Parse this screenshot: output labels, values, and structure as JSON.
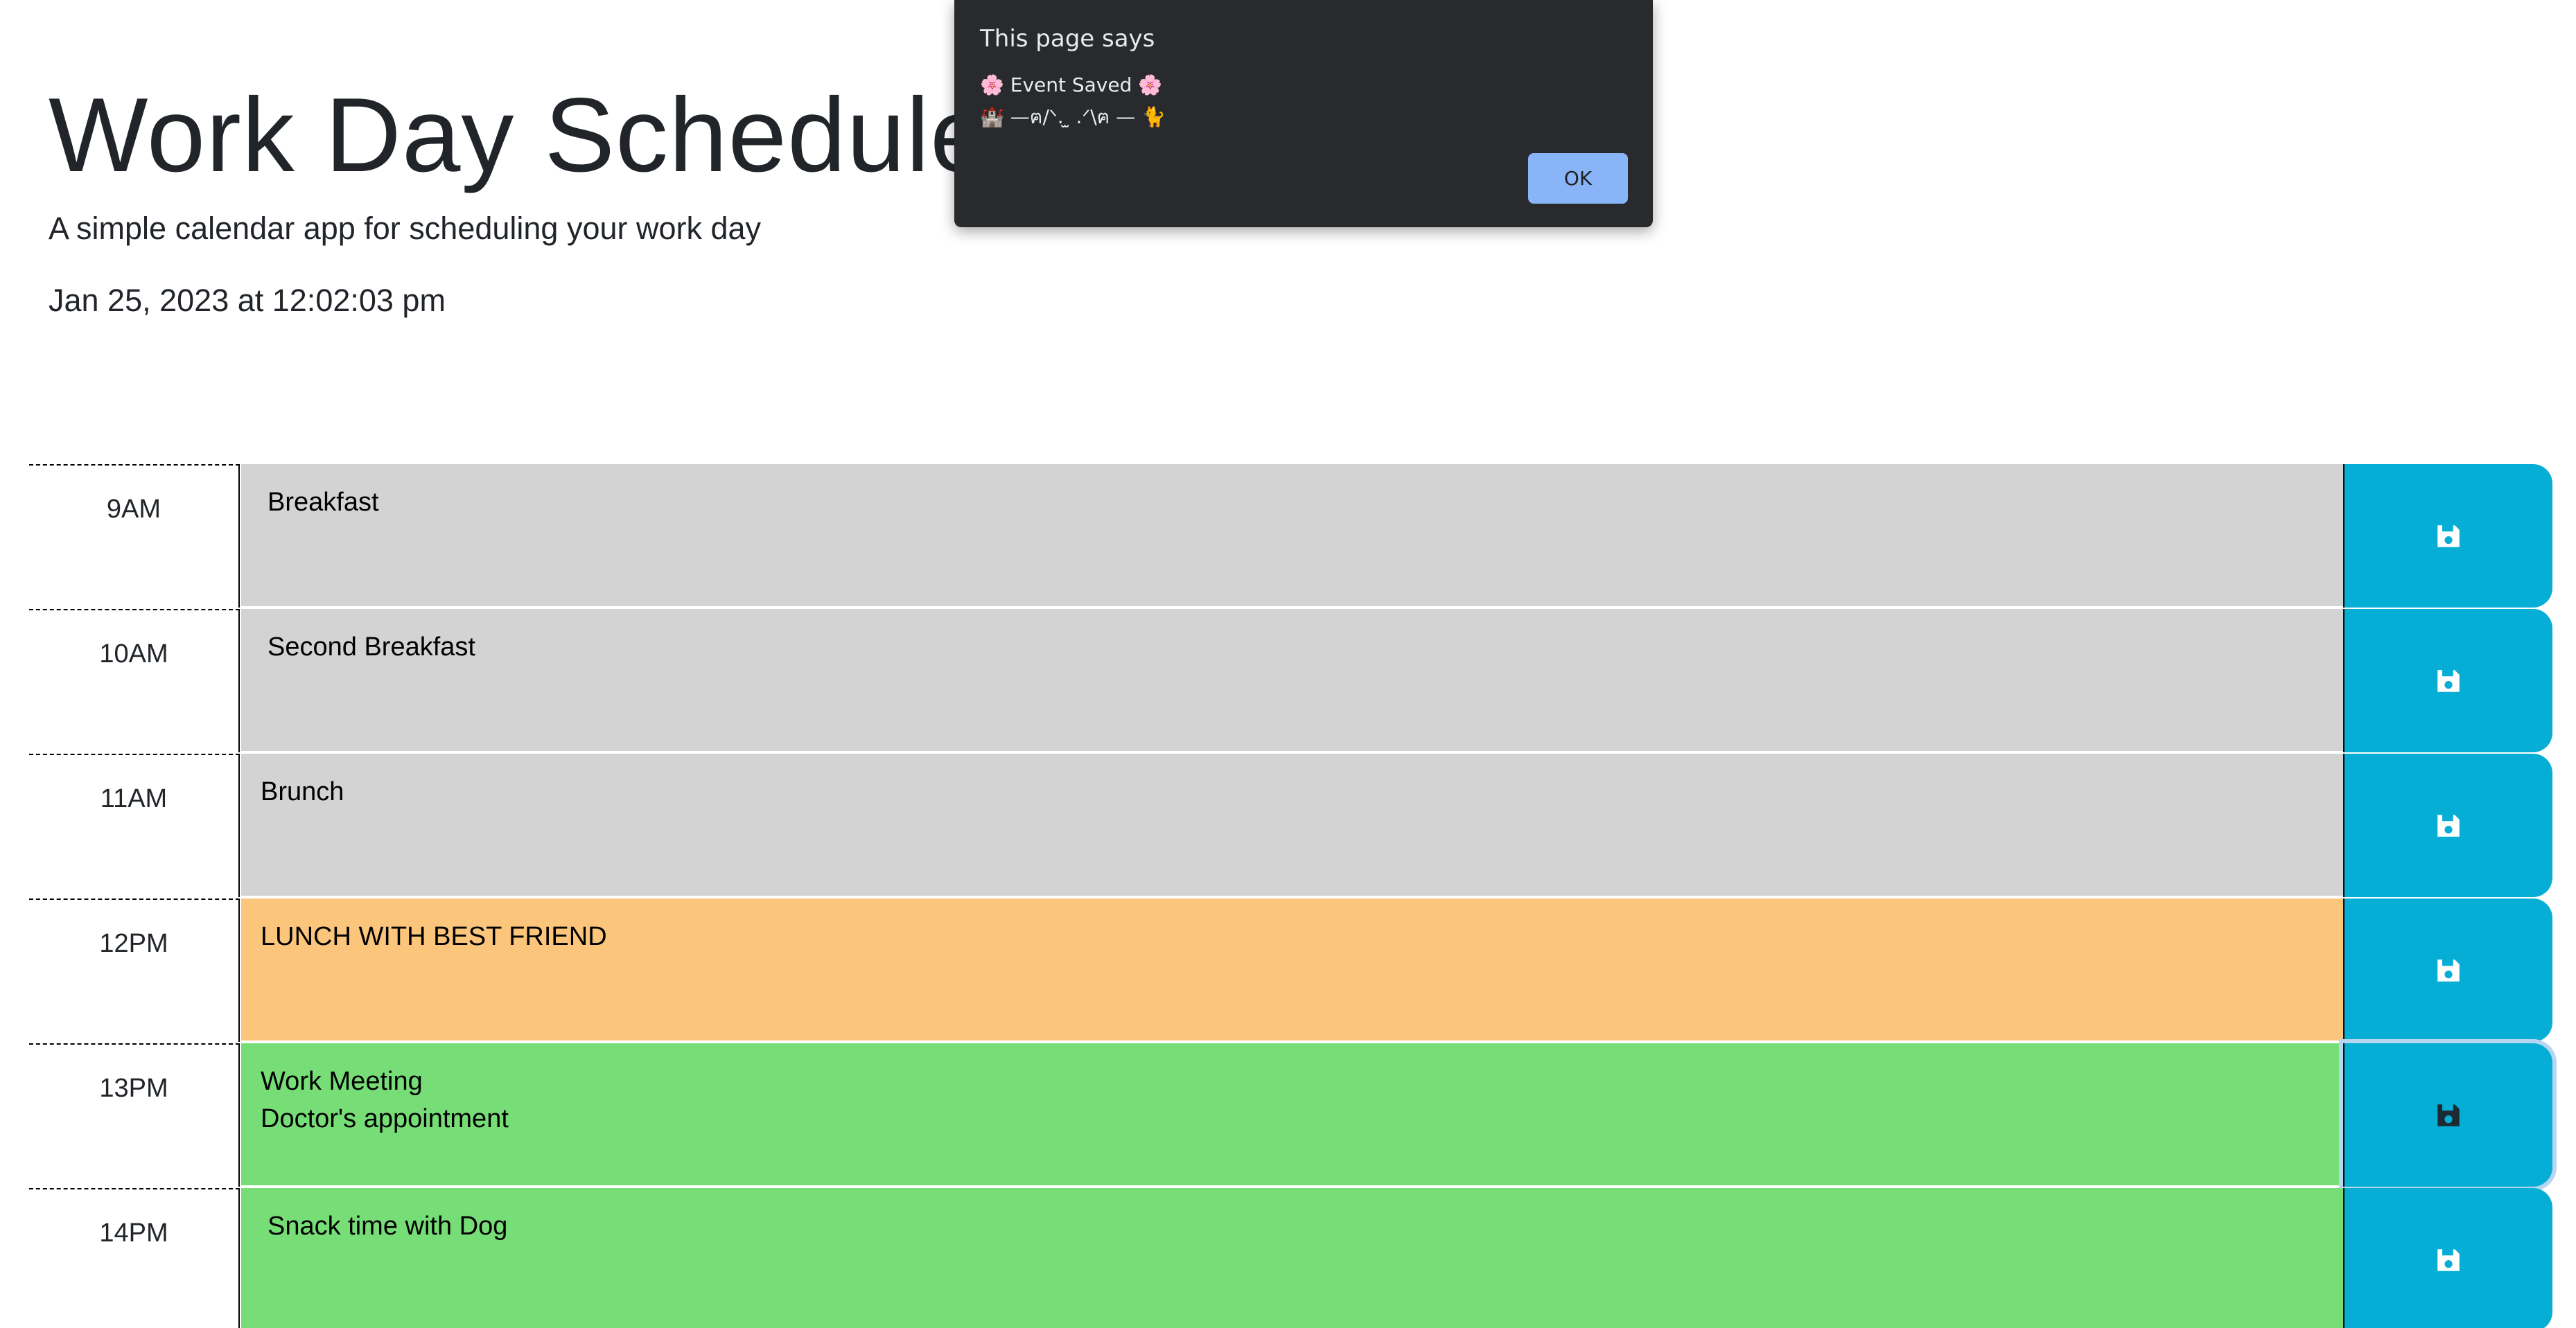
{
  "header": {
    "title": "Work Day Scheduler",
    "subtitle": "A simple calendar app for scheduling your work day",
    "current_datetime": "Jan 25, 2023 at 12:02:03 pm"
  },
  "rows": [
    {
      "hour": "9AM",
      "text": "Breakfast",
      "state": "past",
      "save_icon": "floppy-disk-icon"
    },
    {
      "hour": "10AM",
      "text": "Second Breakfast",
      "state": "past",
      "save_icon": "floppy-disk-icon"
    },
    {
      "hour": "11AM",
      "text": "Brunch",
      "state": "past",
      "save_icon": "floppy-disk-icon"
    },
    {
      "hour": "12PM",
      "text": "LUNCH WITH BEST FRIEND",
      "state": "present",
      "save_icon": "floppy-disk-icon"
    },
    {
      "hour": "13PM",
      "text": "Work Meeting\nDoctor's appointment",
      "state": "future",
      "save_icon": "floppy-disk-icon"
    },
    {
      "hour": "14PM",
      "text": "Snack time with Dog",
      "state": "future",
      "save_icon": "floppy-disk-icon"
    }
  ],
  "colors": {
    "past": "#d3d3d3",
    "present": "#fbc67c",
    "future": "#77dd77",
    "save_button": "#06aed5",
    "dialog_bg": "#292a2d",
    "dialog_ok": "#8ab4f8"
  },
  "dialog": {
    "title": "This page says",
    "message": "🌸 Event Saved 🌸\n🏰 —ฅ/ᐠ. ̫ .ᐟ\\ฅ — 🐈",
    "ok_label": "OK"
  }
}
